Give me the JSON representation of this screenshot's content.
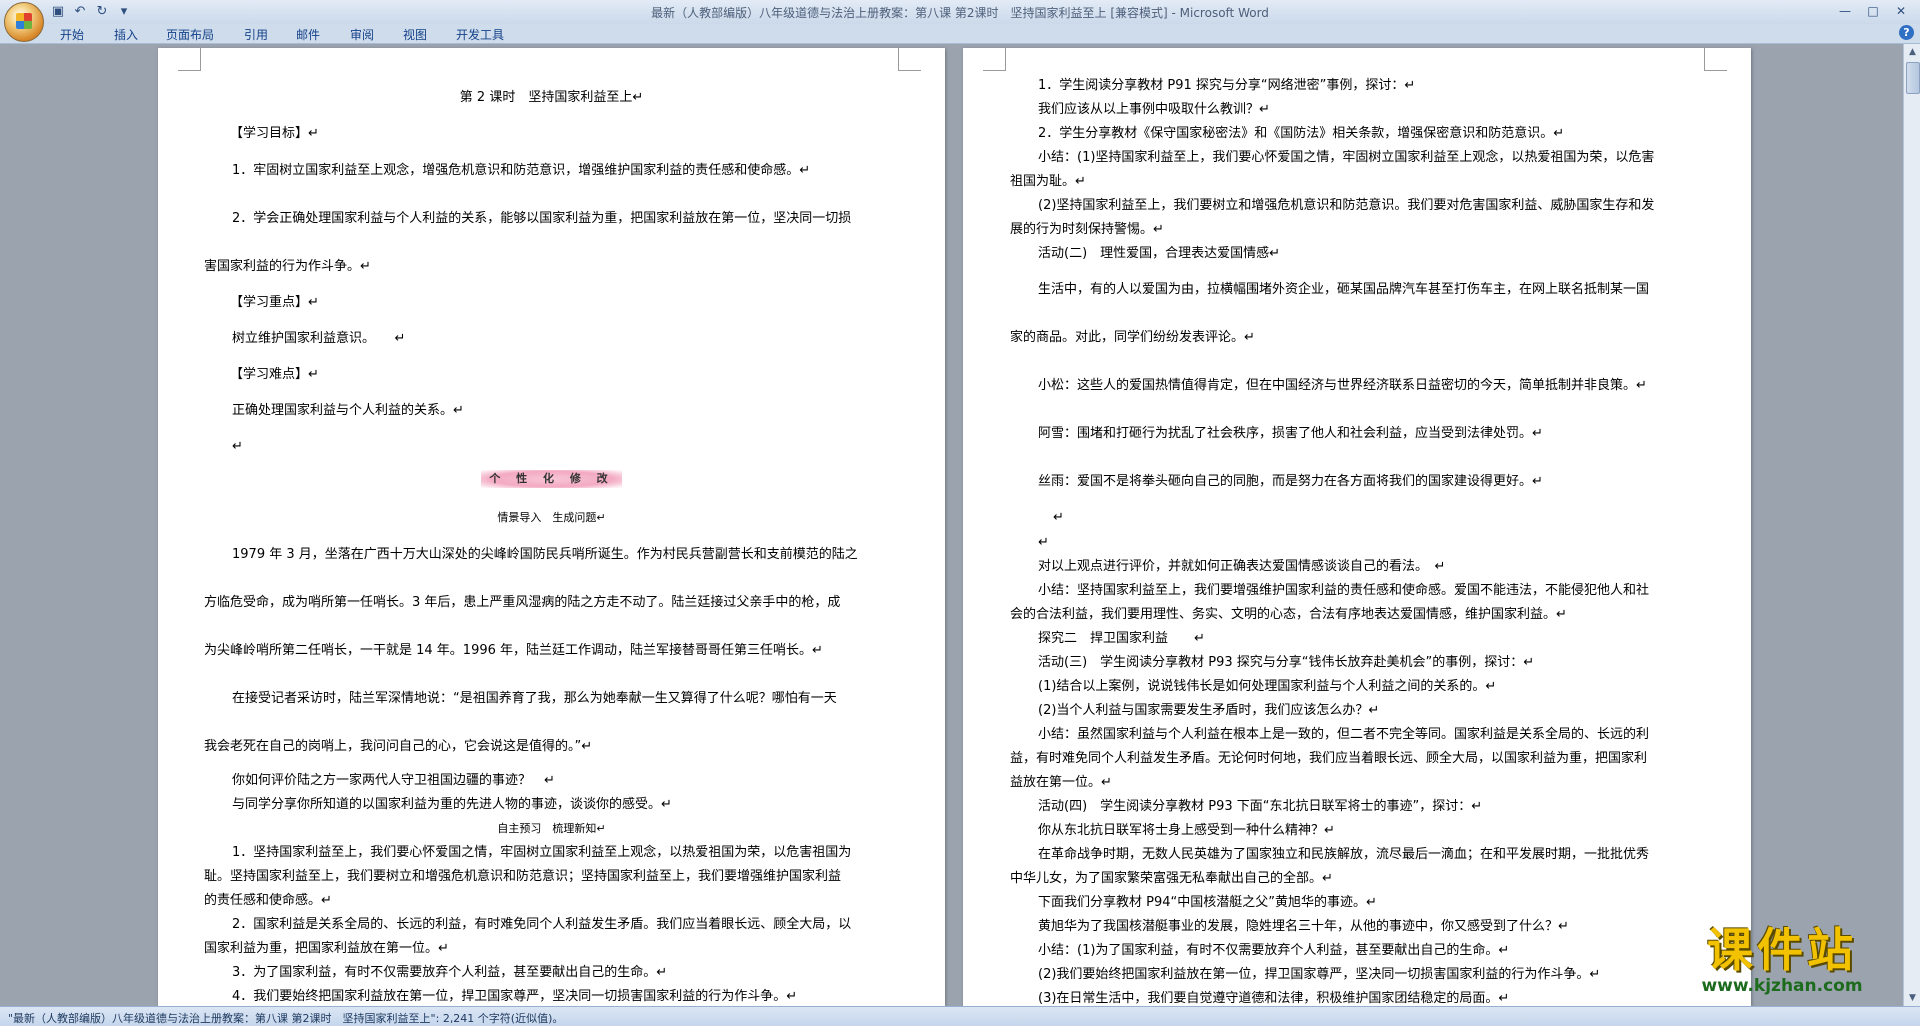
{
  "window": {
    "title": "最新（人教部编版）八年级道德与法治上册教案：第八课 第2课时　坚持国家利益至上 [兼容模式] - Microsoft Word"
  },
  "ribbon": {
    "tabs": [
      "开始",
      "插入",
      "页面布局",
      "引用",
      "邮件",
      "审阅",
      "视图",
      "开发工具"
    ]
  },
  "left_page": {
    "lines": [
      "第 2 课时　坚持国家利益至上↵",
      "【学习目标】↵",
      "1．牢固树立国家利益至上观念，增强危机意识和防范意识，增强维护国家利益的责任感和使命感。↵",
      "2．学会正确处理国家利益与个人利益的关系，能够以国家利益为重，把国家利益放在第一位，坚决同一切损",
      "害国家利益的行为作斗争。↵",
      "【学习重点】↵",
      "树立维护国家利益意识。　　↵",
      "【学习难点】↵",
      "正确处理国家利益与个人利益的关系。↵",
      "↵",
      "个 性 化 修 改",
      "情景导入　生成问题↵",
      "1979 年 3 月，坐落在广西十万大山深处的尖峰岭国防民兵哨所诞生。作为村民兵营副营长和支前模范的陆之",
      "方临危受命，成为哨所第一任哨长。3 年后，患上严重风湿病的陆之方走不动了。陆兰廷接过父亲手中的枪，成",
      "为尖峰岭哨所第二任哨长，一干就是 14 年。1996 年，陆兰廷工作调动，陆兰军接替哥哥任第三任哨长。↵",
      "在接受记者采访时，陆兰军深情地说：“是祖国养育了我，那么为她奉献一生又算得了什么呢？哪怕有一天",
      "我会老死在自己的岗哨上，我问问自己的心，它会说这是值得的。”↵",
      "你如何评价陆之方一家两代人守卫祖国边疆的事迹？　↵",
      "与同学分享你所知道的以国家利益为重的先进人物的事迹，谈谈你的感受。↵",
      "自主预习　梳理新知↵",
      "1．坚持国家利益至上，我们要心怀爱国之情，牢固树立国家利益至上观念，以热爱祖国为荣，以危害祖国为",
      "耻。坚持国家利益至上，我们要树立和增强危机意识和防范意识；坚持国家利益至上，我们要增强维护国家利益",
      "的责任感和使命感。↵",
      "2．国家利益是关系全局的、长远的利益，有时难免同个人利益发生矛盾。我们应当着眼长远、顾全大局，以",
      "国家利益为重，把国家利益放在第一位。↵",
      "3．为了国家利益，有时不仅需要放弃个人利益，甚至要献出自己的生命。↵",
      "4．我们要始终把国家利益放在第一位，捍卫国家尊严，坚决同一切损害国家利益的行为作斗争。↵"
    ]
  },
  "right_page": {
    "lines": [
      "1．学生阅读分享教材 P91 探究与分享“网络泄密”事例，探讨：↵",
      "我们应该从以上事例中吸取什么教训？↵",
      "2．学生分享教材《保守国家秘密法》和《国防法》相关条款，增强保密意识和防范意识。↵",
      "小结：(1)坚持国家利益至上，我们要心怀爱国之情，牢固树立国家利益至上观念，以热爱祖国为荣，以危害",
      "祖国为耻。↵",
      "(2)坚持国家利益至上，我们要树立和增强危机意识和防范意识。我们要对危害国家利益、威胁国家生存和发",
      "展的行为时刻保持警惕。↵",
      "活动(二)　理性爱国，合理表达爱国情感↵",
      "生活中，有的人以爱国为由，拉横幅围堵外资企业，砸某国品牌汽车甚至打伤车主，在网上联名抵制某一国",
      "家的商品。对此，同学们纷纷发表评论。↵",
      "小松：这些人的爱国热情值得肯定，但在中国经济与世界经济联系日益密切的今天，简单抵制并非良策。↵",
      "阿雪：围堵和打砸行为扰乱了社会秩序，损害了他人和社会利益，应当受到法律处罚。↵",
      "丝雨：爱国不是将拳头砸向自己的同胞，而是努力在各方面将我们的国家建设得更好。↵",
      "↵",
      "↵",
      "对以上观点进行评价，并就如何正确表达爱国情感谈谈自己的看法。　↵",
      "小结：坚持国家利益至上，我们要增强维护国家利益的责任感和使命感。爱国不能违法，不能侵犯他人和社",
      "会的合法利益，我们要用理性、务实、文明的心态，合法有序地表达爱国情感，维护国家利益。↵",
      "探究二　捍卫国家利益　　↵",
      "活动(三)　学生阅读分享教材 P93 探究与分享“钱伟长放弃赴美机会”的事例，探讨：↵",
      "(1)结合以上案例，说说钱伟长是如何处理国家利益与个人利益之间的关系的。↵",
      "(2)当个人利益与国家需要发生矛盾时，我们应该怎么办？↵",
      "小结：虽然国家利益与个人利益在根本上是一致的，但二者不完全等同。国家利益是关系全局的、长远的利",
      "益，有时难免同个人利益发生矛盾。无论何时何地，我们应当着眼长远、顾全大局，以国家利益为重，把国家利",
      "益放在第一位。↵",
      "活动(四)　学生阅读分享教材 P93 下面“东北抗日联军将士的事迹”，探讨：↵",
      "你从东北抗日联军将士身上感受到一种什么精神？↵",
      "在革命战争时期，无数人民英雄为了国家独立和民族解放，流尽最后一滴血；在和平发展时期，一批批优秀",
      "中华儿女，为了国家繁荣富强无私奉献出自己的全部。↵",
      "下面我们分享教材 P94“中国核潜艇之父”黄旭华的事迹。↵",
      "黄旭华为了我国核潜艇事业的发展，隐姓埋名三十年，从他的事迹中，你又感受到了什么？↵",
      "小结：(1)为了国家利益，有时不仅需要放弃个人利益，甚至要献出自己的生命。↵",
      "(2)我们要始终把国家利益放在第一位，捍卫国家尊严，坚决同一切损害国家利益的行为作斗争。↵",
      "(3)在日常生活中，我们要自觉遵守道德和法律，积极维护国家团结稳定的局面。↵"
    ]
  },
  "status_bar": {
    "text": "\"最新（人教部编版）八年级道德与法治上册教案：第八课 第2课时　坚持国家利益至上\": 2,241 个字符(近似值)。"
  },
  "watermark": {
    "text": "课件站",
    "url": "www.kjzhan.com"
  },
  "icons": [
    "office-button-icon",
    "save-icon",
    "undo-icon",
    "redo-icon",
    "customize-qat-icon",
    "minimize-icon",
    "maximize-icon",
    "close-icon",
    "help-icon"
  ]
}
